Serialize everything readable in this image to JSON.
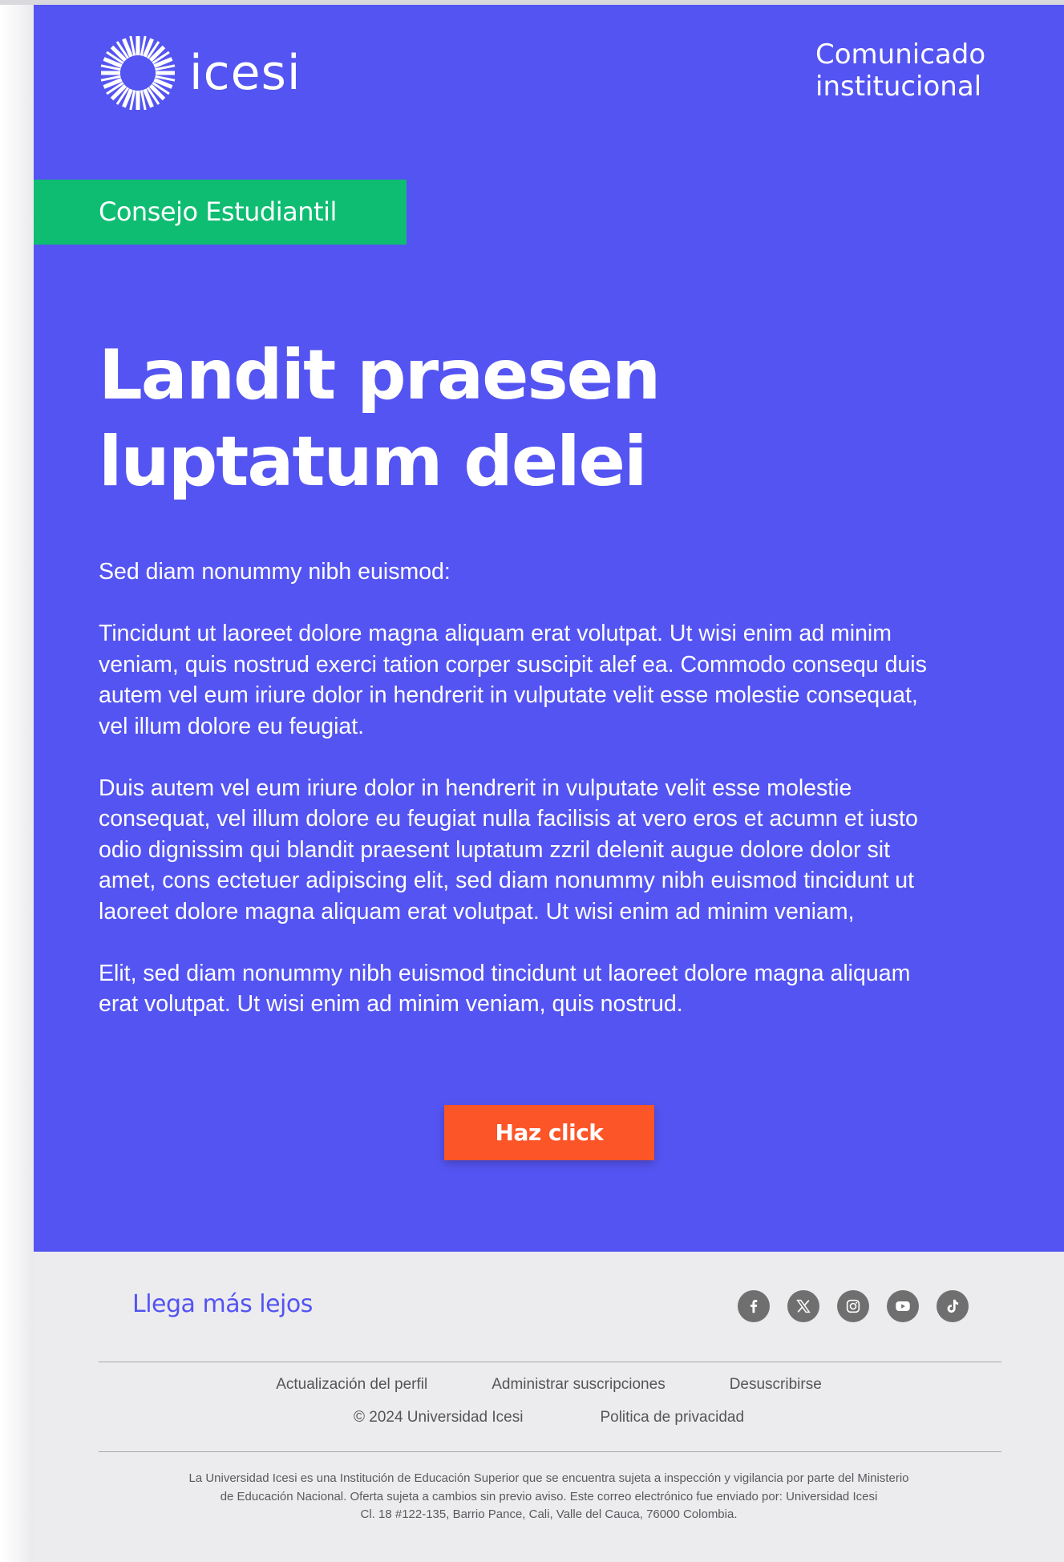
{
  "header": {
    "logo_text": "icesi",
    "comunicado_line1": "Comunicado",
    "comunicado_line2": "institucional"
  },
  "tag": {
    "label": "Consejo Estudiantil"
  },
  "headline": {
    "line1": "Landit praesen",
    "line2": "luptatum delei"
  },
  "body": {
    "intro": "Sed diam nonummy nibh euismod:",
    "paragraph1": [
      "Tincidunt ut laoreet dolore magna aliquam erat volutpat. Ut wisi enim ad minim",
      "veniam, quis nostrud exerci tation corper suscipit  alef ea. Commodo consequ duis",
      "autem vel eum iriure dolor in hendrerit in vulputate velit esse molestie consequat,",
      "vel illum dolore eu feugiat."
    ],
    "paragraph2": [
      "Duis autem vel eum iriure dolor in hendrerit in vulputate velit esse molestie",
      "consequat, vel illum dolore eu feugiat nulla facilisis at vero eros et acumn et iusto",
      "odio dignissim qui blandit praesent luptatum zzril delenit augue dolore dolor sit",
      "amet, cons ectetuer adipiscing elit, sed diam nonummy nibh euismod tincidunt ut",
      "laoreet dolore magna aliquam erat volutpat. Ut wisi enim ad minim veniam,"
    ],
    "paragraph3": [
      "Elit, sed diam nonummy nibh euismod tincidunt ut laoreet dolore magna aliquam",
      "erat volutpat. Ut wisi enim ad minim veniam, quis nostrud."
    ]
  },
  "cta": {
    "label": "Haz click"
  },
  "footer": {
    "tagline": "Llega más lejos",
    "social": [
      "facebook-icon",
      "x-icon",
      "instagram-icon",
      "youtube-icon",
      "tiktok-icon"
    ],
    "links_row1": [
      "Actualización del perfil",
      "Administrar suscripciones",
      "Desuscribirse"
    ],
    "copyright": "© 2024 Universidad Icesi",
    "privacy": "Politica de privacidad",
    "legal": [
      "La Universidad Icesi es una Institución de Educación Superior que se encuentra sujeta a inspección y vigilancia por parte del Ministerio",
      "de Educación Nacional. Oferta sujeta a cambios sin previo aviso. Este correo electrónico fue enviado por: Universidad Icesi",
      "Cl. 18 #122-135, Barrio Pance, Cali, Valle del Cauca, 76000 Colombia."
    ]
  },
  "colors": {
    "hero_bg": "#5454f2",
    "tag_bg": "#0ebd72",
    "cta_bg": "#fb5528",
    "footer_bg": "#ececef",
    "tagline": "#5454f2",
    "social_icon": "#6f6f6f"
  }
}
